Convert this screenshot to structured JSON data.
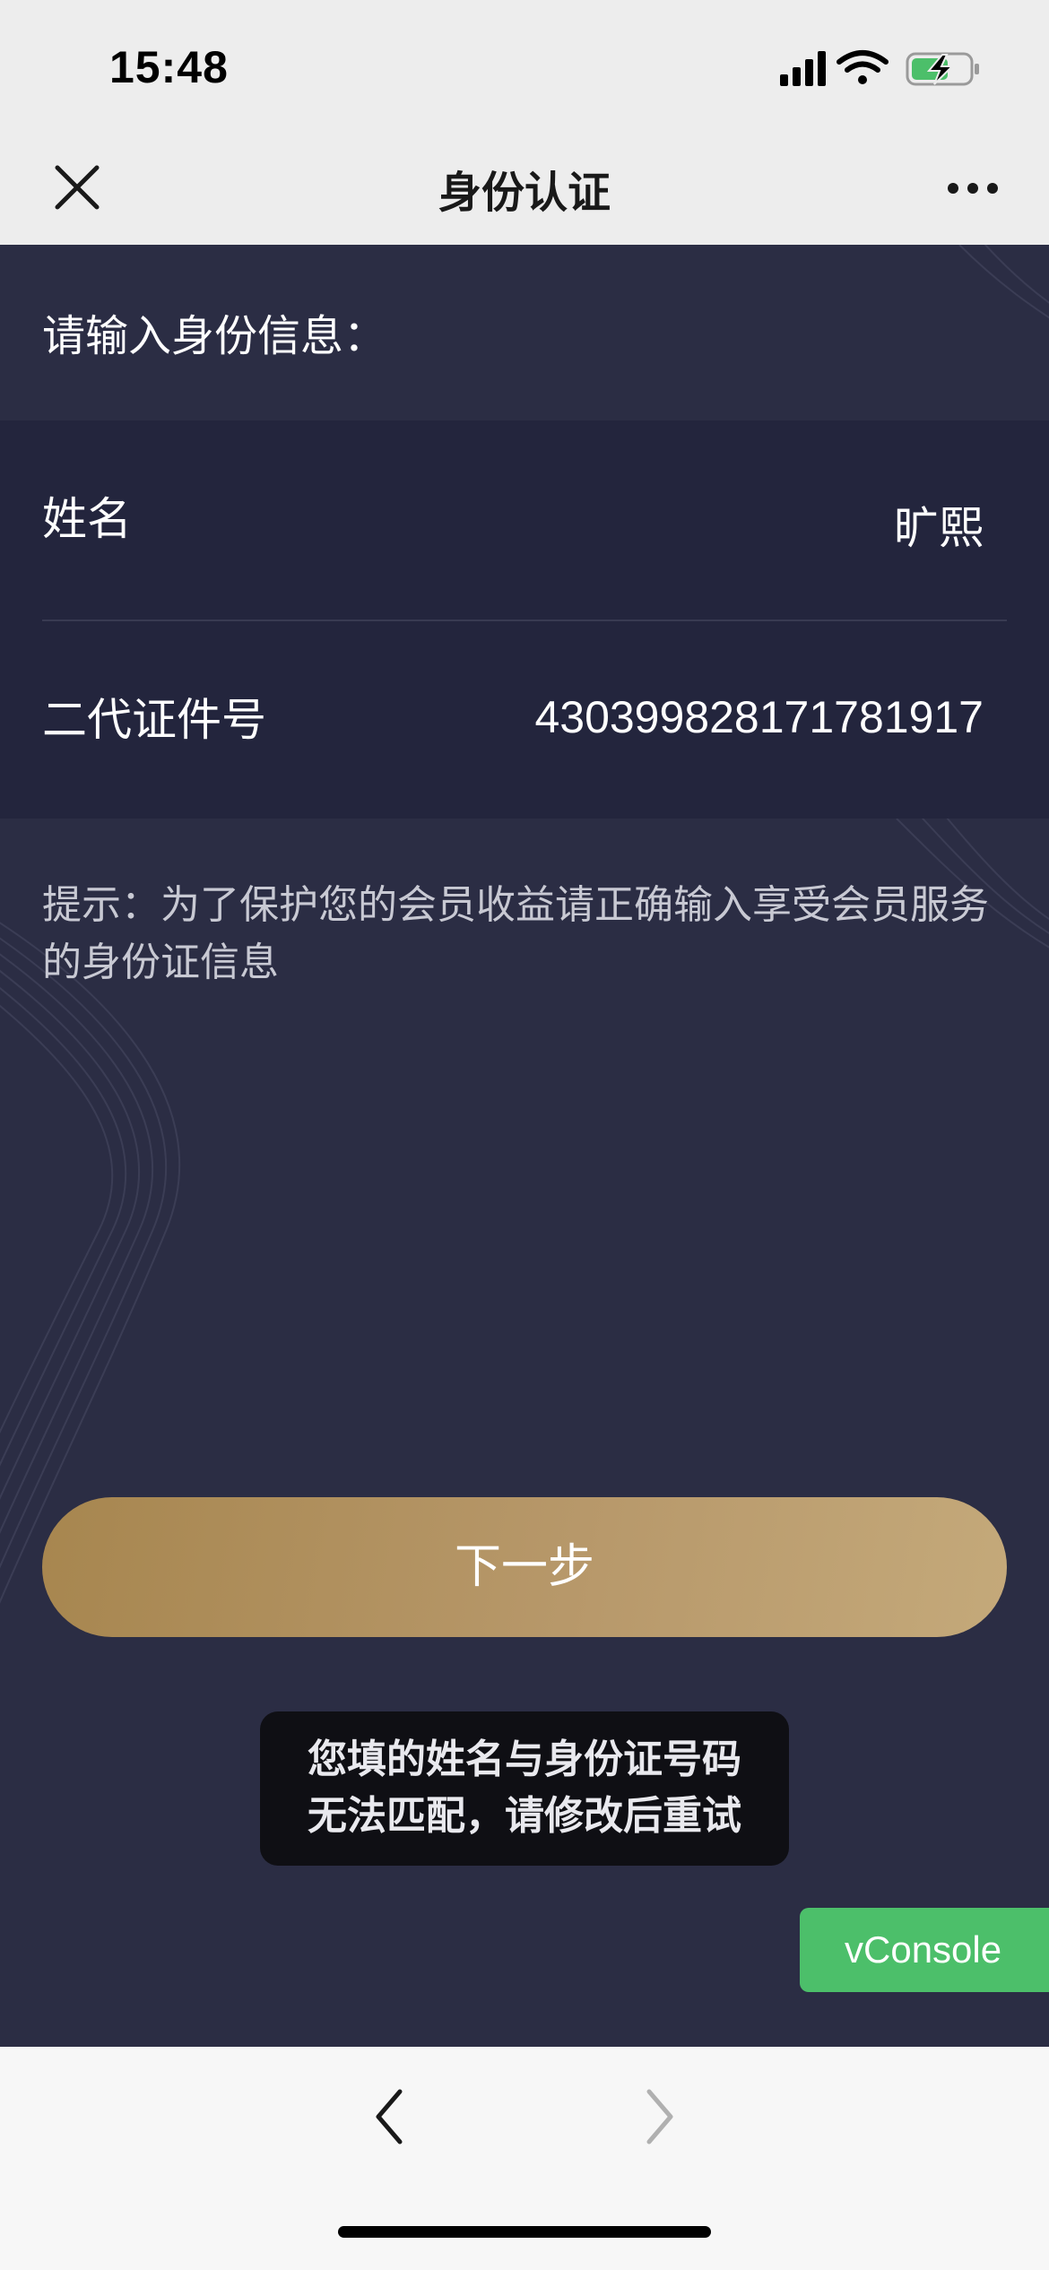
{
  "status_bar": {
    "time": "15:48",
    "icons": [
      "signal-icon",
      "wifi-icon",
      "battery-charging-icon"
    ]
  },
  "nav": {
    "title": "身份认证",
    "close_icon": "close-icon",
    "more_icon": "more-icon"
  },
  "form": {
    "prompt": "请输入身份信息：",
    "name_label": "姓名",
    "name_value": "旷熙",
    "id_label": "二代证件号",
    "id_value": "430399828171781917"
  },
  "hint": "提示：为了保护您的会员收益请正确输入享受会员服务的身份证信息",
  "next_button": "下一步",
  "toast": {
    "line1": "您填的姓名与身份证号码",
    "line2": "无法匹配，请修改后重试"
  },
  "vconsole": "vConsole",
  "colors": {
    "content_bg": "#2b2d44",
    "form_bg": "#23253d",
    "button_gold": "#b7986a",
    "vconsole_green": "#4cbf6a"
  }
}
